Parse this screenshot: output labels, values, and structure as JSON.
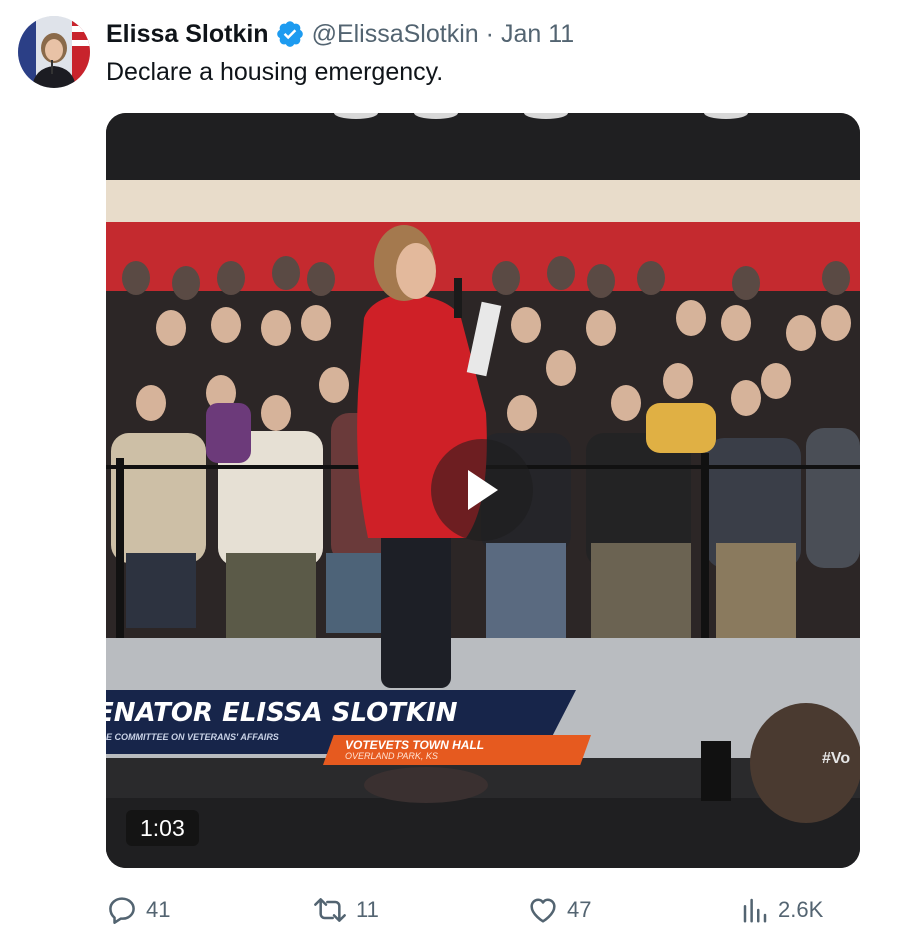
{
  "tweet": {
    "author_name": "Elissa Slotkin",
    "handle": "@ElissaSlotkin",
    "separator": "·",
    "date": "Jan 11",
    "text": "Declare a housing emergency."
  },
  "media": {
    "duration": "1:03",
    "chyron_title": "ENATOR ELISSA SLOTKIN",
    "chyron_subtitle": "E COMMITTEE ON VETERANS' AFFAIRS",
    "event_title": "VOTEVETS TOWN HALL",
    "event_location": "OVERLAND PARK, KS",
    "hashtag": "#Vo"
  },
  "actions": {
    "replies": "41",
    "reposts": "11",
    "likes": "47",
    "views": "2.6K"
  },
  "icons": {
    "verified": "verified-badge-icon",
    "play": "play-icon",
    "reply": "reply-icon",
    "repost": "repost-icon",
    "like": "heart-icon",
    "views": "analytics-icon"
  },
  "colors": {
    "verified_blue": "#1d9bf0",
    "secondary_text": "#536471",
    "chyron_navy": "#17254a",
    "chyron_orange": "#e65a1f",
    "jacket_red": "#cf2027"
  }
}
